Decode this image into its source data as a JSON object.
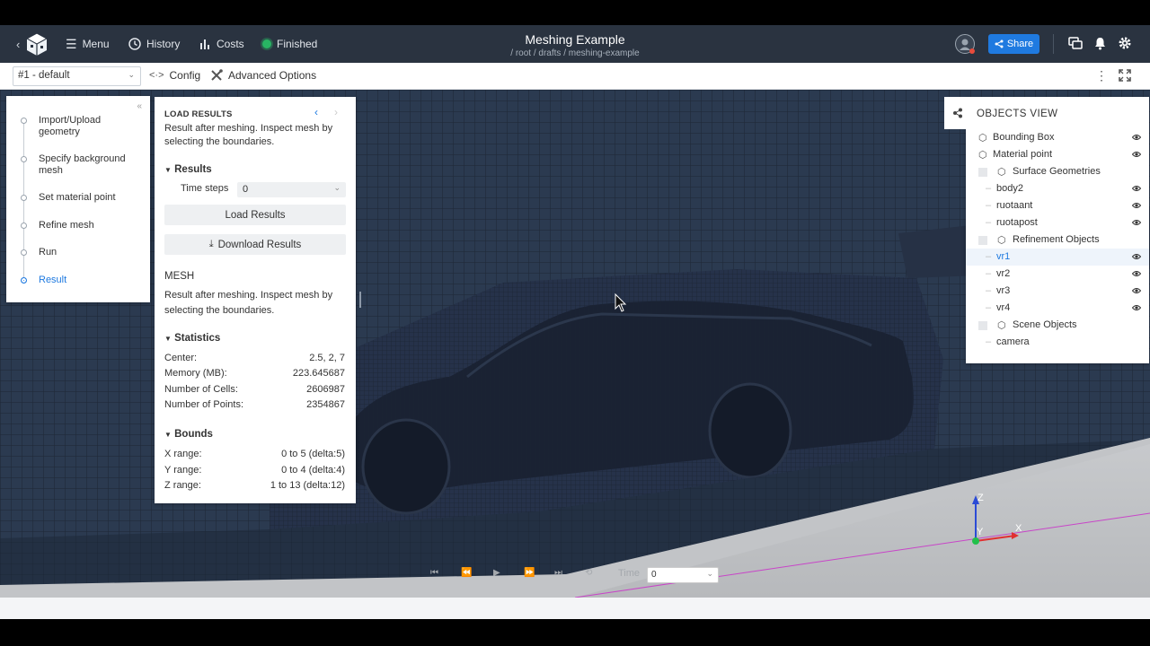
{
  "topbar": {
    "menu_label": "Menu",
    "history_label": "History",
    "costs_label": "Costs",
    "status_label": "Finished",
    "title": "Meshing Example",
    "breadcrumb": "/ root / drafts / meshing-example",
    "share_label": "Share"
  },
  "subbar": {
    "config_select": "#1 - default",
    "config_label": "Config",
    "advanced_label": "Advanced Options"
  },
  "steps": [
    {
      "label": "Import/Upload geometry"
    },
    {
      "label": "Specify background mesh"
    },
    {
      "label": "Set material point"
    },
    {
      "label": "Refine mesh"
    },
    {
      "label": "Run"
    },
    {
      "label": "Result"
    }
  ],
  "load_results": {
    "heading": "LOAD RESULTS",
    "description": "Result after meshing. Inspect mesh by selecting the boundaries.",
    "results_heading": "Results",
    "time_steps_label": "Time steps",
    "time_steps_value": "0",
    "load_button": "Load Results",
    "download_button": "Download Results",
    "mesh_heading": "MESH",
    "mesh_description": "Result after meshing. Inspect mesh by selecting the boundaries.",
    "statistics_heading": "Statistics",
    "statistics": [
      {
        "label": "Center:",
        "value": "2.5, 2, 7"
      },
      {
        "label": "Memory (MB):",
        "value": "223.645687"
      },
      {
        "label": "Number of Cells:",
        "value": "2606987"
      },
      {
        "label": "Number of Points:",
        "value": "2354867"
      }
    ],
    "bounds_heading": "Bounds",
    "bounds": [
      {
        "label": "X range:",
        "value": "0 to 5 (delta:5)"
      },
      {
        "label": "Y range:",
        "value": "0 to 4 (delta:4)"
      },
      {
        "label": "Z range:",
        "value": "1 to 13 (delta:12)"
      }
    ]
  },
  "objects_view": {
    "heading": "OBJECTS VIEW",
    "items": [
      {
        "label": "Bounding Box"
      },
      {
        "label": "Material point"
      },
      {
        "label": "Surface Geometries"
      },
      {
        "label": "body2"
      },
      {
        "label": "ruotaant"
      },
      {
        "label": "ruotapost"
      },
      {
        "label": "Refinement Objects"
      },
      {
        "label": "vr1"
      },
      {
        "label": "vr2"
      },
      {
        "label": "vr3"
      },
      {
        "label": "vr4"
      },
      {
        "label": "Scene Objects"
      },
      {
        "label": "camera"
      }
    ]
  },
  "axes": {
    "z": "Z",
    "y": "Y",
    "x": "X"
  },
  "playbar": {
    "time_label": "Time",
    "time_value": "0"
  },
  "colors": {
    "accent": "#1f7ae0",
    "topbar": "#2a3340",
    "status": "#28b463",
    "mesh": "#29364a"
  }
}
